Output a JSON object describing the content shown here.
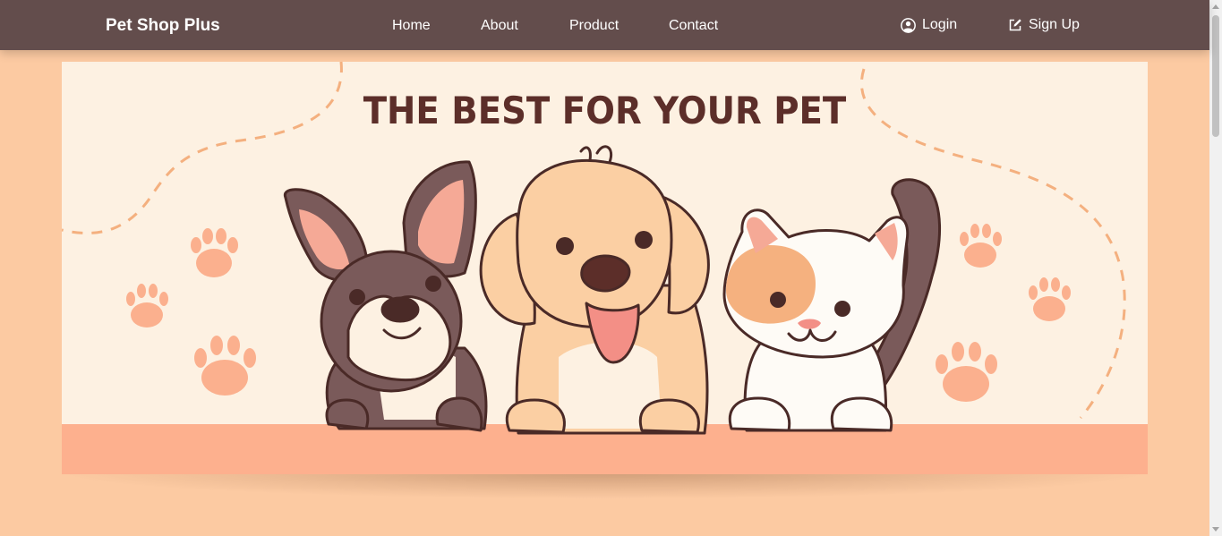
{
  "nav": {
    "brand": "Pet Shop Plus",
    "links": [
      {
        "label": "Home"
      },
      {
        "label": "About"
      },
      {
        "label": "Product"
      },
      {
        "label": "Contact"
      }
    ],
    "login_label": "Login",
    "signup_label": "Sign Up"
  },
  "hero": {
    "title": "THE BEST FOR YOUR PET",
    "image_alt_icons": [
      "dog-boston-terrier",
      "dog-golden-puppy",
      "cat-calico",
      "paw-print"
    ]
  },
  "colors": {
    "navbar": "#634d4c",
    "page_background": "#fccaa2",
    "banner_background": "#fdf1e2",
    "banner_floor": "#fdb08e",
    "title": "#5c2e29",
    "paw": "#fbb08e"
  }
}
